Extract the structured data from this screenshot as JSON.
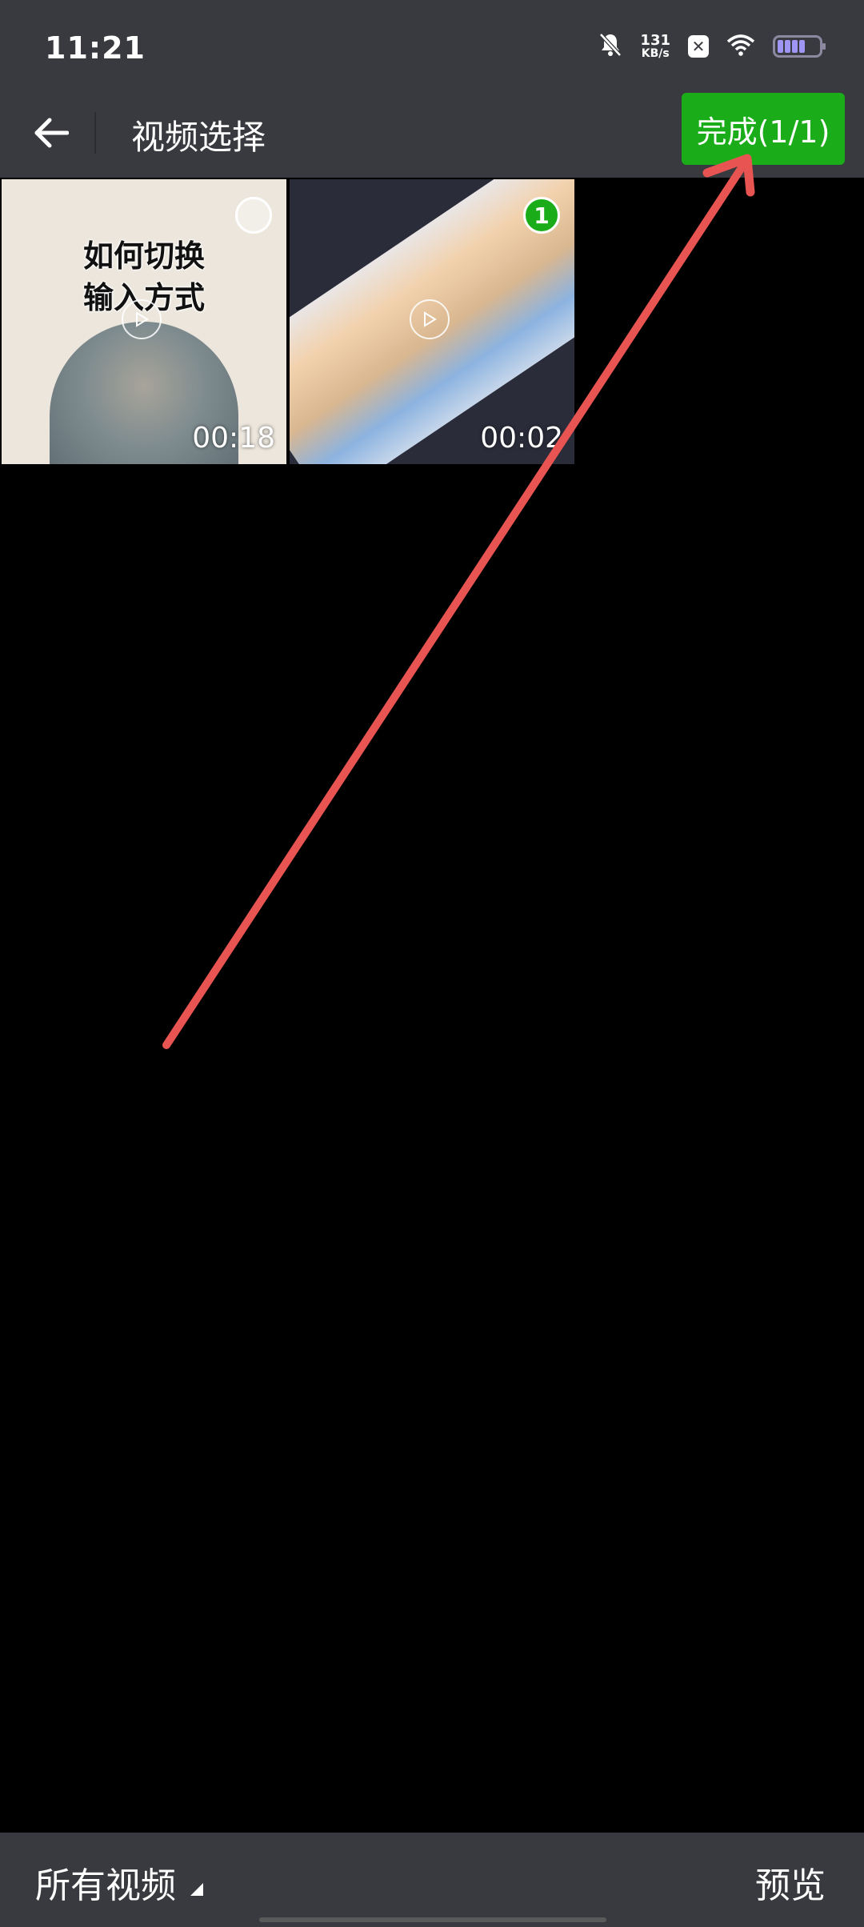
{
  "status_bar": {
    "time": "11:21",
    "net_speed_value": "131",
    "net_speed_unit": "KB/s",
    "icons": [
      "bell-muted-icon",
      "x-app-icon",
      "wifi-icon",
      "battery-icon"
    ]
  },
  "header": {
    "title": "视频选择",
    "done_button": "完成(1/1)",
    "back_icon": "arrow-left-icon"
  },
  "videos": [
    {
      "overlay_text_line1": "如何切换",
      "overlay_text_line2": "输入方式",
      "duration": "00:18",
      "selected": false
    },
    {
      "duration": "00:02",
      "selected": true,
      "selection_index": "1"
    }
  ],
  "footer": {
    "album_label": "所有视频",
    "preview_label": "预览"
  },
  "colors": {
    "bar_bg": "#393a3f",
    "accent_green": "#1aad19",
    "annotation_red": "#e85451"
  }
}
